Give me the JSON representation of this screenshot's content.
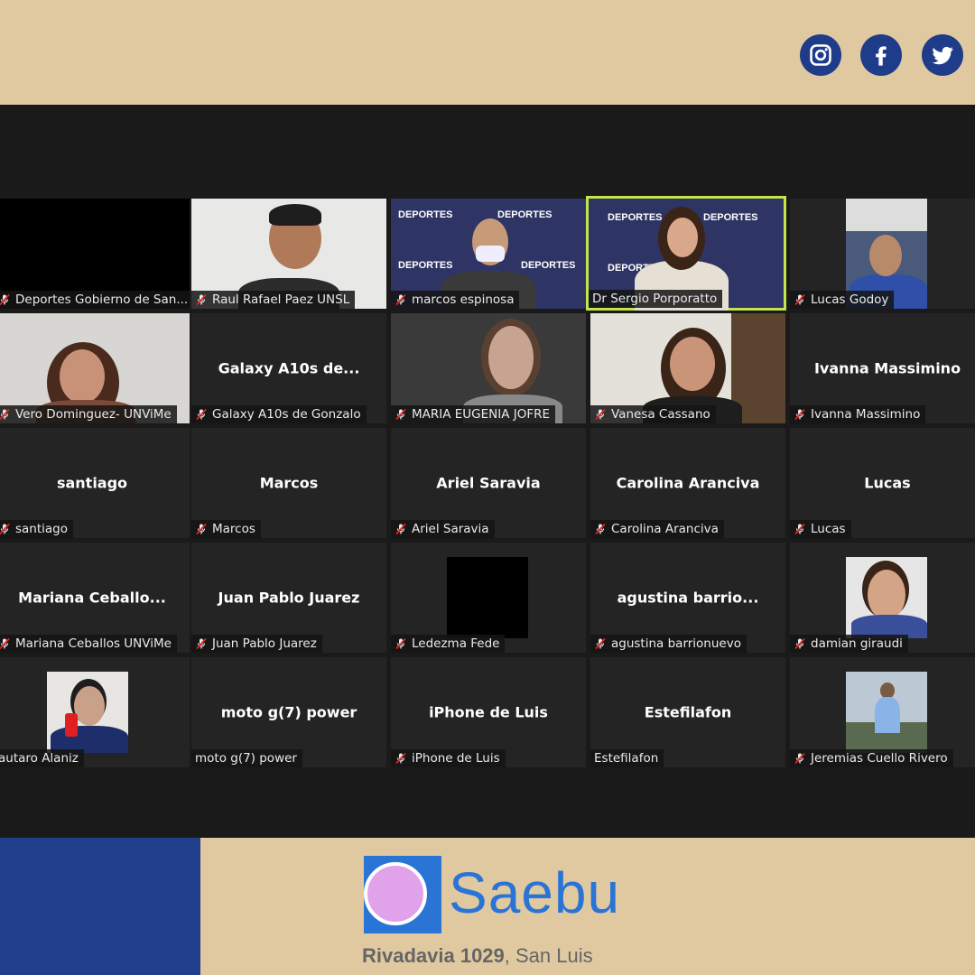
{
  "social": {
    "instagram": "instagram-icon",
    "facebook": "facebook-icon",
    "twitter": "twitter-icon"
  },
  "colors": {
    "beige": "#e0c9a0",
    "navy": "#223f8c",
    "brand_blue": "#2a74d6",
    "active_border": "#c4e54a",
    "tile_bg": "#242424"
  },
  "participants": [
    {
      "label": "Deportes Gobierno de San..."
    },
    {
      "label": "Raul Rafael Paez UNSL"
    },
    {
      "label": "marcos espinosa"
    },
    {
      "label": "Dr Sergio Porporatto"
    },
    {
      "label": "Lucas Godoy"
    },
    {
      "label": "Vero Dominguez- UNViMe"
    },
    {
      "label": "Galaxy A10s de Gonzalo",
      "display": "Galaxy A10s de..."
    },
    {
      "label": "MARIA EUGENIA JOFRE"
    },
    {
      "label": "Vanesa Cassano"
    },
    {
      "label": "Ivanna Massimino",
      "display": "Ivanna Massimino"
    },
    {
      "label": "santiago",
      "display": "santiago"
    },
    {
      "label": "Marcos",
      "display": "Marcos"
    },
    {
      "label": "Ariel Saravia",
      "display": "Ariel Saravia"
    },
    {
      "label": "Carolina Aranciva",
      "display": "Carolina Aranciva"
    },
    {
      "label": "Lucas",
      "display": "Lucas"
    },
    {
      "label": "Mariana Ceballos UNViMe",
      "display": "Mariana  Ceballo..."
    },
    {
      "label": "Juan Pablo Juarez",
      "display": "Juan Pablo Juarez"
    },
    {
      "label": "Ledezma Fede"
    },
    {
      "label": "agustina barrionuevo",
      "display": "agustina  barrio..."
    },
    {
      "label": "damian giraudi"
    },
    {
      "label": "autaro Alaniz"
    },
    {
      "label": "moto g(7) power",
      "display": "moto g(7) power"
    },
    {
      "label": "iPhone de Luis",
      "display": "iPhone de Luis"
    },
    {
      "label": "Estefilafon",
      "display": "Estefilafon"
    },
    {
      "label": "Jeremias Cuello Rivero"
    }
  ],
  "footer": {
    "brand": "Saebu",
    "address_bold": "Rivadavia 1029",
    "address_rest": ", San Luis"
  }
}
